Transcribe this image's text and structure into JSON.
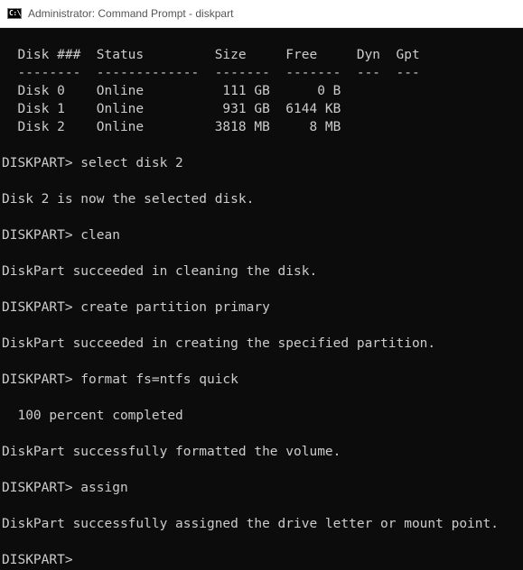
{
  "window": {
    "title": "Administrator: Command Prompt - diskpart",
    "icon_glyph": "C:\\",
    "icon_name": "command-prompt-icon"
  },
  "colors": {
    "console_background": "#0c0c0c",
    "console_text": "#cccccc",
    "titlebar_background": "#ffffff",
    "titlebar_text": "#555555"
  },
  "console": {
    "lines": [
      "  Disk ###  Status         Size     Free     Dyn  Gpt",
      "  --------  -------------  -------  -------  ---  ---",
      "  Disk 0    Online          111 GB      0 B",
      "  Disk 1    Online          931 GB  6144 KB",
      "  Disk 2    Online         3818 MB     8 MB",
      "",
      "DISKPART> select disk 2",
      "",
      "Disk 2 is now the selected disk.",
      "",
      "DISKPART> clean",
      "",
      "DiskPart succeeded in cleaning the disk.",
      "",
      "DISKPART> create partition primary",
      "",
      "DiskPart succeeded in creating the specified partition.",
      "",
      "DISKPART> format fs=ntfs quick",
      "",
      "  100 percent completed",
      "",
      "DiskPart successfully formatted the volume.",
      "",
      "DISKPART> assign",
      "",
      "DiskPart successfully assigned the drive letter or mount point.",
      "",
      "DISKPART> "
    ]
  }
}
